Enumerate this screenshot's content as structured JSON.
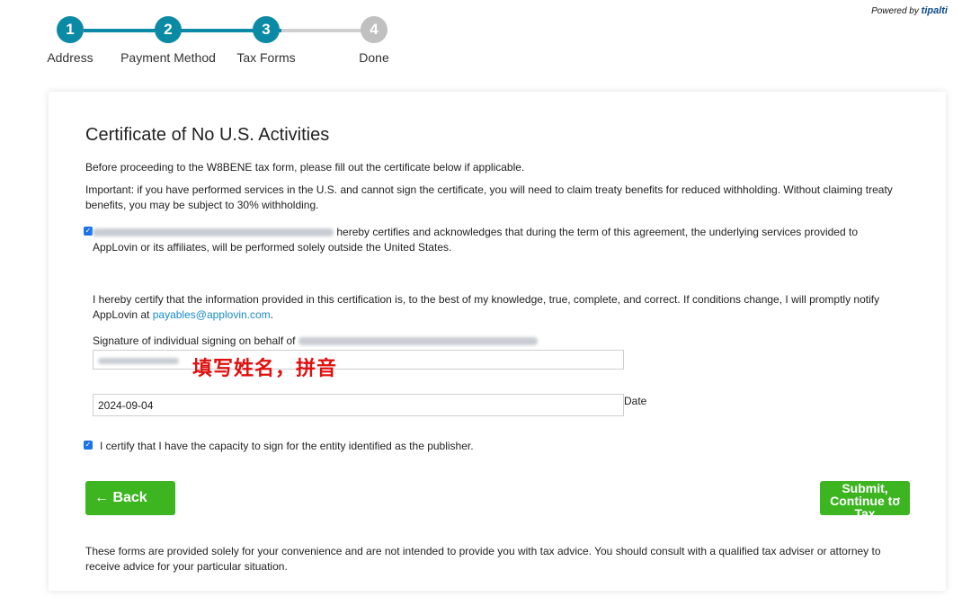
{
  "stepper": {
    "steps": [
      {
        "number": "1",
        "label": "Address",
        "state": "done"
      },
      {
        "number": "2",
        "label": "Payment Method",
        "state": "done"
      },
      {
        "number": "3",
        "label": "Tax Forms",
        "state": "done"
      },
      {
        "number": "4",
        "label": "Done",
        "state": "todo"
      }
    ],
    "active_color": "#0b8aa6",
    "inactive_color": "#c0c0c0"
  },
  "powered_by": {
    "prefix": "Powered by",
    "brand": "tipalti"
  },
  "form": {
    "title": "Certificate of No U.S. Activities",
    "intro": "Before proceeding to the W8BENE tax form, please fill out the certificate below if applicable.",
    "important": "Important: if you have performed services in the U.S. and cannot sign the certificate, you will need to claim treaty benefits for reduced withholding. Without claiming treaty benefits, you may be subject to 30% withholding.",
    "cert_checkbox_checked": true,
    "cert_text": "hereby certifies and acknowledges that during the term of this agreement, the underlying services provided to AppLovin or its affiliates, will be performed solely outside the United States.",
    "certify_text_1": "I hereby certify that the information provided in this certification is, to the best of my knowledge, true, complete, and correct. If conditions change, I will promptly notify AppLovin at",
    "certify_email": "payables@applovin.com",
    "certify_text_2": ".",
    "signature_label": "Signature of individual signing on behalf of",
    "annotation": "填写姓名，拼音",
    "date_value": "2024-09-04",
    "date_label": "Date",
    "capacity_checkbox_checked": true,
    "capacity_text": "I certify that I have the capacity to sign for the entity identified as the publisher.",
    "back_label": "Back",
    "submit_label": "Submit, Continue to Tax",
    "disclaimer": "These forms are provided solely for your convenience and are not intended to provide you with tax advice. You should consult with a qualified tax adviser or attorney to receive advice for your particular situation."
  },
  "colors": {
    "button_green": "#3cb521",
    "link": "#1a8bc7",
    "annotation_red": "#e01010"
  }
}
